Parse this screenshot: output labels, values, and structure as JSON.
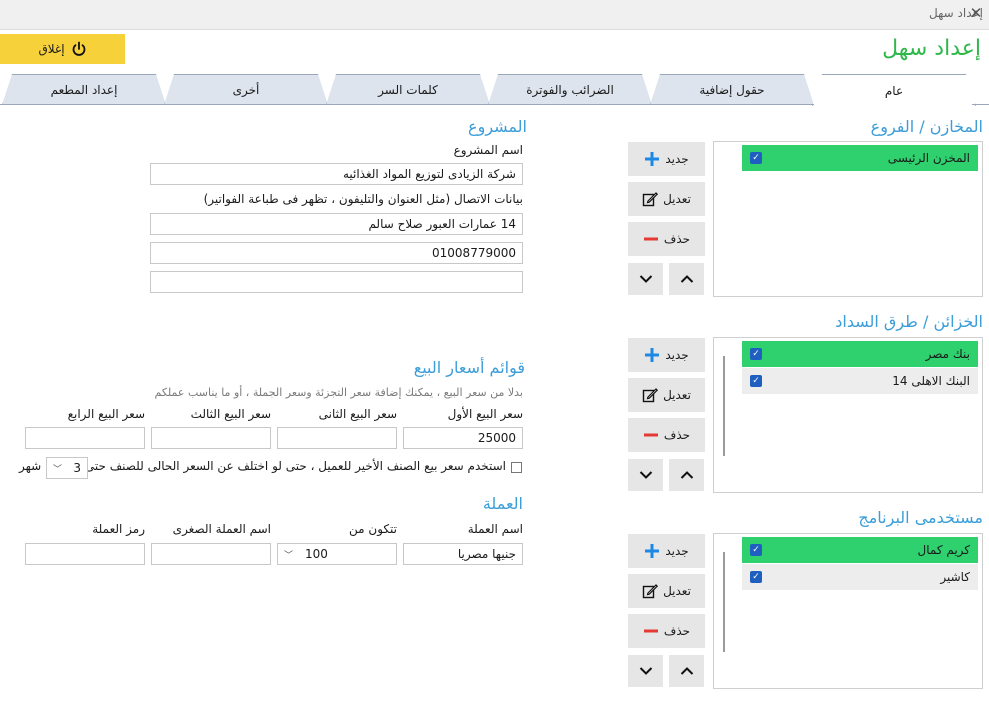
{
  "window": {
    "title": "إعداد سهل"
  },
  "header": {
    "close_label": "إغلاق",
    "app_title": "إعداد سهل"
  },
  "tabs": [
    {
      "label": "عام"
    },
    {
      "label": "حقول إضافية"
    },
    {
      "label": "الضرائب والفوترة"
    },
    {
      "label": "كلمات السر"
    },
    {
      "label": "أخرى"
    },
    {
      "label": "إعداد المطعم"
    }
  ],
  "buttons": {
    "new": "جديد",
    "edit": "تعديل",
    "delete": "حذف"
  },
  "stores": {
    "title": "المخازن / الفروع",
    "items": [
      {
        "label": "المخزن الرئيسى",
        "checked": true
      }
    ]
  },
  "payment": {
    "title": "الخزائن / طرق السداد",
    "items": [
      {
        "label": "بنك مصر",
        "checked": true
      },
      {
        "label": "البنك الاهلى 14",
        "checked": true
      }
    ]
  },
  "users": {
    "title": "مستخدمى البرنامج",
    "items": [
      {
        "label": "كريم كمال",
        "checked": true
      },
      {
        "label": "كاشير",
        "checked": true
      }
    ]
  },
  "project": {
    "title": "المشروع",
    "name_label": "اسم المشروع",
    "name_value": "شركة الزيادى لتوزيع المواد الغذائيه",
    "contact_label": "بيانات الاتصال (مثل العنوان والتليفون ، تظهر فى طباعة الفواتير)",
    "contact_line1": "14 عمارات العبور صلاح سالم",
    "contact_line2": "01008779000",
    "contact_line3": ""
  },
  "prices": {
    "title": "قوائم أسعار البيع",
    "hint": "بدلا من سعر البيع ، يمكنك إضافة سعر التجزئة وسعر الجملة ، أو ما يناسب عملكم",
    "labels": [
      "سعر البيع الأول",
      "سعر البيع الثانى",
      "سعر البيع الثالث",
      "سعر البيع الرابع"
    ],
    "values": [
      "25000",
      "",
      "",
      ""
    ],
    "last_price_label": "استخدم سعر بيع الصنف الأخير للعميل ، حتى لو اختلف عن السعر الحالى للصنف حتى",
    "months_value": "3",
    "months_unit": "شهر"
  },
  "currency": {
    "title": "العملة",
    "name_label": "اسم العملة",
    "consists_label": "تتكون من",
    "minor_label": "اسم العملة الصغرى",
    "symbol_label": "رمز العملة",
    "name_value": "جنيها مصريا",
    "consists_value": "100",
    "minor_value": "",
    "symbol_value": ""
  }
}
